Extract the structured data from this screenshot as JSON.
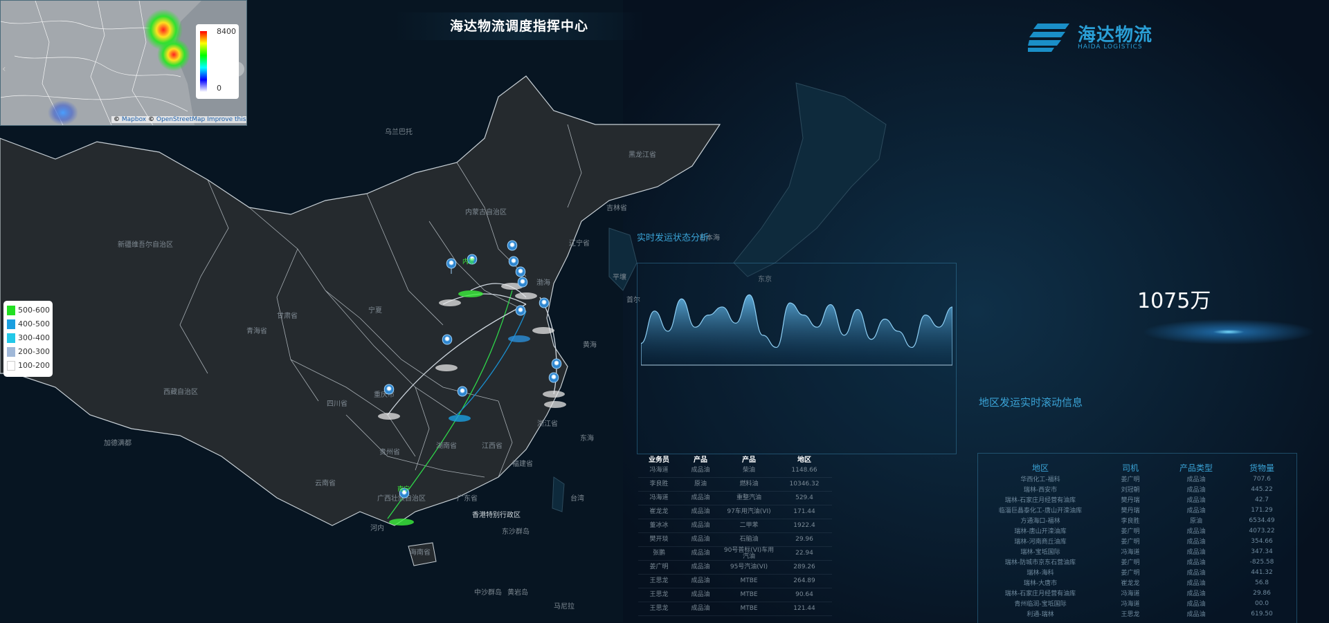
{
  "header": {
    "title": "海达物流调度指挥中心"
  },
  "logo": {
    "name": "海达物流",
    "sub": "HAIDA LOGISTICS",
    "color": "#2a9fd6"
  },
  "heatmap": {
    "max_label": "8400",
    "min_label": "0",
    "attribution": {
      "prefix": "©",
      "mapbox": "Mapbox",
      "sep": "©",
      "osm": "OpenStreetMap",
      "improve": "Improve this map"
    }
  },
  "legend": [
    {
      "label": "500-600",
      "color": "#22e022"
    },
    {
      "label": "400-500",
      "color": "#1a9fe0"
    },
    {
      "label": "300-400",
      "color": "#22c8e8"
    },
    {
      "label": "200-300",
      "color": "#a0b8d8"
    },
    {
      "label": "100-200",
      "color": "#ffffff"
    }
  ],
  "map_labels": [
    "乌兰巴托",
    "黑龙江省",
    "吉林省",
    "辽宁省",
    "内蒙古自治区",
    "新疆维吾尔自治区",
    "西藏自治区",
    "青海省",
    "甘肃省",
    "宁夏",
    "四川省",
    "重庆市",
    "贵州省",
    "云南省",
    "湖南省",
    "江西省",
    "福建省",
    "浙江省",
    "广东省",
    "广西壮族自治区",
    "海南省",
    "香港特别行政区",
    "台湾",
    "东沙群岛",
    "中沙群岛",
    "黄岩岛",
    "马尼拉",
    "河内",
    "加德满都",
    "东京",
    "平壤",
    "首尔",
    "日本海",
    "东海",
    "渤海",
    "黄海"
  ],
  "city_labels": {
    "top": "内蒙",
    "south": "南宁"
  },
  "realtime_panel": {
    "title": "实时发运状态分析"
  },
  "total": {
    "value": "1075万"
  },
  "scroll_panel": {
    "title": "地区发运实时滚动信息"
  },
  "sales_table": {
    "headers": [
      "业务员",
      "产品",
      "产品",
      "地区"
    ],
    "rows": [
      [
        "冯海道",
        "成品油",
        "柴油",
        "1148.66"
      ],
      [
        "李良胜",
        "原油",
        "燃料油",
        "10346.32"
      ],
      [
        "冯海道",
        "成品油",
        "重整汽油",
        "529.4"
      ],
      [
        "崔龙龙",
        "成品油",
        "97车用汽油(VI)",
        "171.44"
      ],
      [
        "董冰冰",
        "成品油",
        "二甲苯",
        "1922.4"
      ],
      [
        "樊开琰",
        "成品油",
        "石脑油",
        "29.96"
      ],
      [
        "张鹏",
        "成品油",
        "90号普标(VI)车用汽油",
        "22.94"
      ],
      [
        "姜广明",
        "成品油",
        "95号汽油(VI)",
        "289.26"
      ],
      [
        "王思龙",
        "成品油",
        "MTBE",
        "264.89"
      ],
      [
        "王思龙",
        "成品油",
        "MTBE",
        "90.64"
      ],
      [
        "王思龙",
        "成品油",
        "MTBE",
        "121.44"
      ]
    ]
  },
  "region_table": {
    "headers": [
      "地区",
      "司机",
      "产品类型",
      "货物量"
    ],
    "rows": [
      [
        "华西化工-福科",
        "姜广明",
        "成品油",
        "707.6"
      ],
      [
        "瑞林-西安市",
        "刘冠朝",
        "成品油",
        "445.22"
      ],
      [
        "瑞林-石家庄月经营有油库",
        "樊丹瑞",
        "成品油",
        "42.7"
      ],
      [
        "临淄巨晶泰化工-唐山开滦油库",
        "樊丹瑞",
        "成品油",
        "171.29"
      ],
      [
        "方通海口-福林",
        "李良胜",
        "原油",
        "6534.49"
      ],
      [
        "瑞林-唐山开滦油库",
        "姜广明",
        "成品油",
        "4073.22"
      ],
      [
        "瑞林-河南商丘油库",
        "姜广明",
        "成品油",
        "354.66"
      ],
      [
        "瑞林-宝坻国际",
        "冯海道",
        "成品油",
        "347.34"
      ],
      [
        "瑞林-防城市京东石营油库",
        "姜广明",
        "成品油",
        "-825.58"
      ],
      [
        "瑞林-海科",
        "姜广明",
        "成品油",
        "441.32"
      ],
      [
        "瑞林-大唐市",
        "崔龙龙",
        "成品油",
        "56.8"
      ],
      [
        "瑞林-石家庄月经营有油库",
        "冯海道",
        "成品油",
        "29.86"
      ],
      [
        "青州临润-宝坻国际",
        "冯海道",
        "成品油",
        "00.0"
      ],
      [
        "利通-瑞林",
        "王思龙",
        "成品油",
        "619.50"
      ]
    ]
  },
  "wave_chart": {
    "values": [
      20,
      60,
      35,
      75,
      40,
      55,
      65,
      45,
      80,
      30,
      15,
      70,
      55,
      40,
      68,
      30,
      62,
      25,
      50,
      35,
      15,
      55,
      40,
      65
    ]
  }
}
